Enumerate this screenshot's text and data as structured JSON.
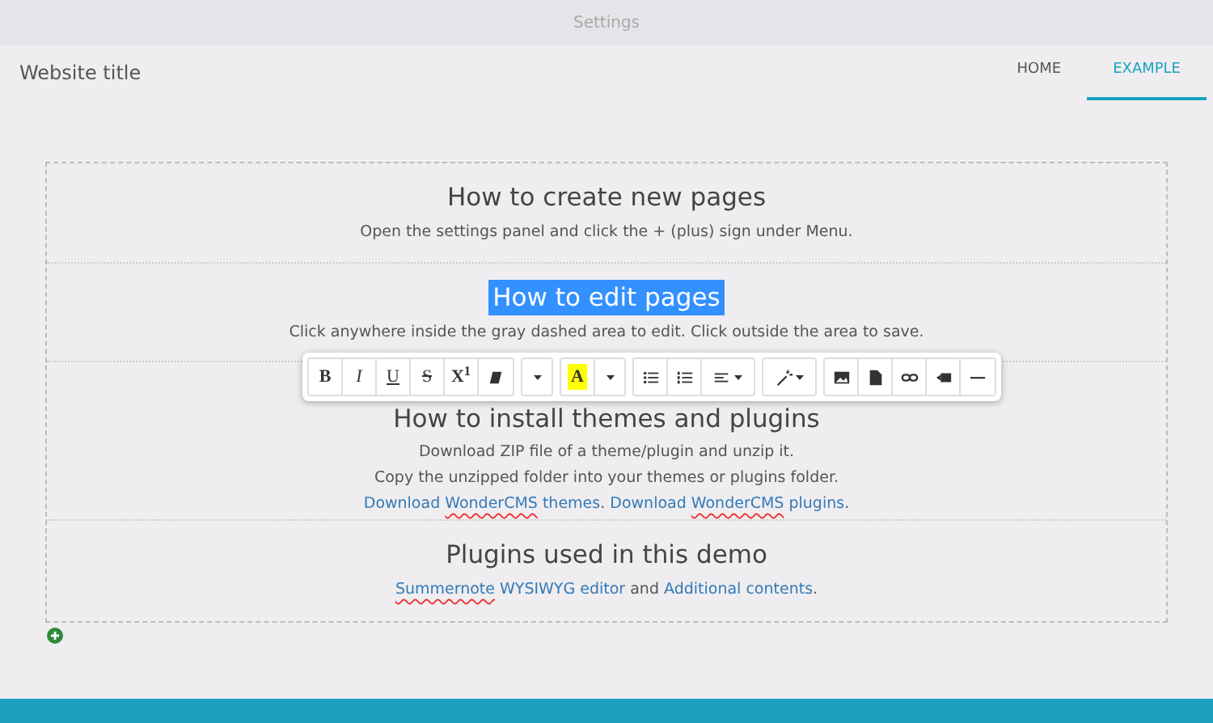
{
  "settings_bar": {
    "label": "Settings"
  },
  "header": {
    "site_title": "Website title",
    "nav": [
      {
        "label": "HOME",
        "selected": false
      },
      {
        "label": "EXAMPLE",
        "selected": true
      }
    ]
  },
  "sections": [
    {
      "heading": "How to create new pages",
      "heading_selected": false,
      "paragraphs": [
        [
          {
            "kind": "text",
            "segments": [
              {
                "text": "Open the settings panel and click the + (plus) sign under Menu."
              }
            ]
          }
        ]
      ]
    },
    {
      "heading": "How to edit pages",
      "heading_selected": true,
      "paragraphs": [
        [
          {
            "kind": "text",
            "segments": [
              {
                "text": "Click anywhere inside the gray dashed area to edit. Click outside the area to save."
              }
            ]
          }
        ]
      ]
    },
    {
      "heading": "How to install themes and plugins",
      "heading_selected": false,
      "paragraphs": [
        [
          {
            "kind": "text",
            "segments": [
              {
                "text": "Download ZIP file of a theme/plugin and unzip it."
              }
            ]
          }
        ],
        [
          {
            "kind": "text",
            "segments": [
              {
                "text": "Copy the unzipped folder into your themes or plugins folder."
              }
            ]
          }
        ],
        [
          {
            "kind": "link",
            "segments": [
              {
                "text": "Download "
              },
              {
                "text": "WonderCMS",
                "misspelled": true
              },
              {
                "text": " themes"
              }
            ]
          },
          {
            "kind": "text",
            "segments": [
              {
                "text": ". "
              }
            ]
          },
          {
            "kind": "link",
            "segments": [
              {
                "text": "Download "
              },
              {
                "text": "WonderCMS",
                "misspelled": true
              },
              {
                "text": " plugins"
              }
            ]
          },
          {
            "kind": "text",
            "segments": [
              {
                "text": "."
              }
            ]
          }
        ]
      ]
    },
    {
      "heading": "Plugins used in this demo",
      "heading_selected": false,
      "paragraphs": [
        [
          {
            "kind": "link",
            "segments": [
              {
                "text": "Summernote",
                "misspelled": true
              },
              {
                "text": " WYSIWYG editor"
              }
            ]
          },
          {
            "kind": "text",
            "segments": [
              {
                "text": " and "
              }
            ]
          },
          {
            "kind": "link",
            "segments": [
              {
                "text": "Additional contents"
              }
            ]
          },
          {
            "kind": "text",
            "segments": [
              {
                "text": "."
              }
            ]
          }
        ]
      ]
    }
  ],
  "toolbar": {
    "groups": [
      [
        {
          "kind": "bold",
          "label": "B"
        },
        {
          "kind": "italic",
          "label": "I"
        },
        {
          "kind": "underline",
          "label": "U"
        },
        {
          "kind": "strike",
          "label": "S"
        },
        {
          "kind": "superscript",
          "label": "X$^{1}$"
        },
        {
          "kind": "eraser"
        }
      ],
      [
        {
          "kind": "caret"
        }
      ],
      [
        {
          "kind": "highlight",
          "label": "A"
        },
        {
          "kind": "caret"
        }
      ],
      [
        {
          "kind": "ul"
        },
        {
          "kind": "ol"
        },
        {
          "kind": "align"
        }
      ],
      [
        {
          "kind": "magic"
        }
      ],
      [
        {
          "kind": "picture"
        },
        {
          "kind": "file"
        },
        {
          "kind": "link"
        },
        {
          "kind": "video"
        },
        {
          "kind": "hr"
        }
      ]
    ]
  }
}
